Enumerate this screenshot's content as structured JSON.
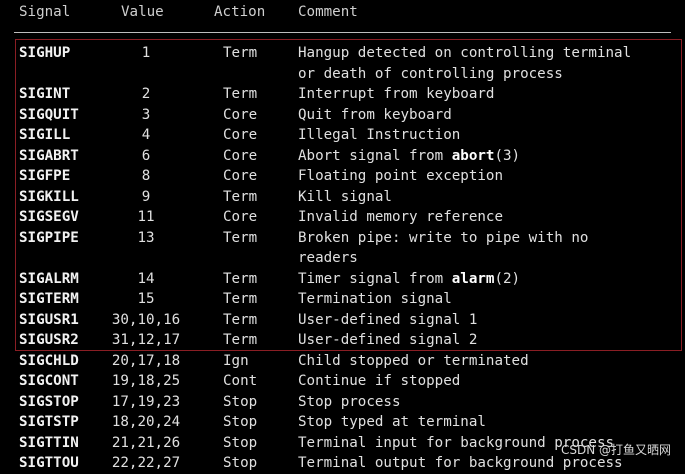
{
  "header": {
    "signal": "Signal",
    "value": "Value",
    "action": "Action",
    "comment": "Comment"
  },
  "rows": [
    {
      "signal": "SIGHUP",
      "value": "1",
      "action": "Term",
      "comment": [
        "Hangup detected on controlling terminal",
        "or death of controlling process"
      ]
    },
    {
      "signal": "SIGINT",
      "value": "2",
      "action": "Term",
      "comment": [
        "Interrupt from keyboard"
      ]
    },
    {
      "signal": "SIGQUIT",
      "value": "3",
      "action": "Core",
      "comment": [
        "Quit from keyboard"
      ]
    },
    {
      "signal": "SIGILL",
      "value": "4",
      "action": "Core",
      "comment": [
        "Illegal Instruction"
      ]
    },
    {
      "signal": "SIGABRT",
      "value": "6",
      "action": "Core",
      "comment": [
        "Abort signal from ",
        {
          "b": "abort"
        },
        "(3)"
      ],
      "inline": true
    },
    {
      "signal": "SIGFPE",
      "value": "8",
      "action": "Core",
      "comment": [
        "Floating point exception"
      ]
    },
    {
      "signal": "SIGKILL",
      "value": "9",
      "action": "Term",
      "comment": [
        "Kill signal"
      ]
    },
    {
      "signal": "SIGSEGV",
      "value": "11",
      "action": "Core",
      "comment": [
        "Invalid memory reference"
      ]
    },
    {
      "signal": "SIGPIPE",
      "value": "13",
      "action": "Term",
      "comment": [
        "Broken pipe: write to pipe with no",
        "readers"
      ]
    },
    {
      "signal": "SIGALRM",
      "value": "14",
      "action": "Term",
      "comment": [
        "Timer signal from ",
        {
          "b": "alarm"
        },
        "(2)"
      ],
      "inline": true
    },
    {
      "signal": "SIGTERM",
      "value": "15",
      "action": "Term",
      "comment": [
        "Termination signal"
      ]
    },
    {
      "signal": "SIGUSR1",
      "value": "30,10,16",
      "action": "Term",
      "comment": [
        "User-defined signal 1"
      ]
    },
    {
      "signal": "SIGUSR2",
      "value": "31,12,17",
      "action": "Term",
      "comment": [
        "User-defined signal 2"
      ]
    },
    {
      "signal": "SIGCHLD",
      "value": "20,17,18",
      "action": "Ign",
      "comment": [
        "Child stopped or terminated"
      ]
    },
    {
      "signal": "SIGCONT",
      "value": "19,18,25",
      "action": "Cont",
      "comment": [
        "Continue if stopped"
      ]
    },
    {
      "signal": "SIGSTOP",
      "value": "17,19,23",
      "action": "Stop",
      "comment": [
        "Stop process"
      ]
    },
    {
      "signal": "SIGTSTP",
      "value": "18,20,24",
      "action": "Stop",
      "comment": [
        "Stop typed at terminal"
      ]
    },
    {
      "signal": "SIGTTIN",
      "value": "21,21,26",
      "action": "Stop",
      "comment": [
        "Terminal input for background process"
      ]
    },
    {
      "signal": "SIGTTOU",
      "value": "22,22,27",
      "action": "Stop",
      "comment": [
        "Terminal output for background process"
      ]
    }
  ],
  "watermark": "CSDN @打鱼又晒网",
  "colors": {
    "background": "#000000",
    "text": "#e0e0e0",
    "highlight_border": "#8a1e24"
  }
}
